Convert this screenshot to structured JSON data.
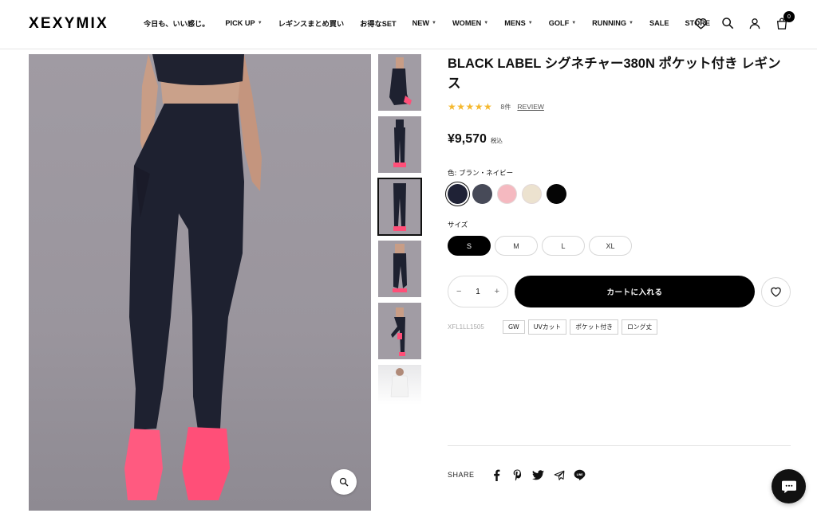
{
  "header": {
    "logo": "XEXYMIX",
    "nav": [
      {
        "label": "今日も、いい感じ。",
        "dropdown": false
      },
      {
        "label": "PICK UP",
        "dropdown": true
      },
      {
        "label": "レギンスまとめ買い",
        "dropdown": false
      },
      {
        "label": "お得なSET",
        "dropdown": false
      },
      {
        "label": "NEW",
        "dropdown": true
      },
      {
        "label": "WOMEN",
        "dropdown": true
      },
      {
        "label": "MENS",
        "dropdown": true
      },
      {
        "label": "GOLF",
        "dropdown": true
      },
      {
        "label": "RUNNING",
        "dropdown": true
      },
      {
        "label": "SALE",
        "dropdown": false
      },
      {
        "label": "STORE",
        "dropdown": false
      }
    ],
    "icons": [
      "heart-icon",
      "search-icon",
      "user-icon",
      "cart-icon"
    ],
    "cart_count": "0"
  },
  "product": {
    "title": "BLACK LABEL シグネチャー380N ポケット付き レギンス",
    "stars": "★★★★★",
    "rating_value": 5,
    "review_count": "8件",
    "review_link": "REVIEW",
    "price": "¥9,570",
    "price_tax": "税込",
    "color_label": "色: ブラン・ネイビー",
    "colors": [
      {
        "hex": "#1f2236",
        "selected": true
      },
      {
        "hex": "#474a58",
        "selected": false
      },
      {
        "hex": "#f5b9c0",
        "selected": false
      },
      {
        "hex": "#ece2cf",
        "selected": false
      },
      {
        "hex": "#050505",
        "selected": false
      }
    ],
    "size_label": "サイズ",
    "sizes": [
      {
        "label": "S",
        "selected": true
      },
      {
        "label": "M",
        "selected": false
      },
      {
        "label": "L",
        "selected": false
      },
      {
        "label": "XL",
        "selected": false
      }
    ],
    "quantity": "1",
    "qty_minus": "−",
    "qty_plus": "+",
    "add_to_cart": "カートに入れる",
    "sku": "XFL1LL1505",
    "tags": [
      "GW",
      "UVカット",
      "ポケット付き",
      "ロング丈"
    ]
  },
  "share": {
    "label": "SHARE",
    "icons": [
      "facebook-icon",
      "pinterest-icon",
      "twitter-icon",
      "telegram-icon",
      "line-icon"
    ]
  },
  "colors": {
    "accent": "#000000",
    "star": "#f5b82e",
    "leggings": "#1e2130",
    "shoes": "#ff4f78",
    "background_photo": "#9e99a1"
  }
}
